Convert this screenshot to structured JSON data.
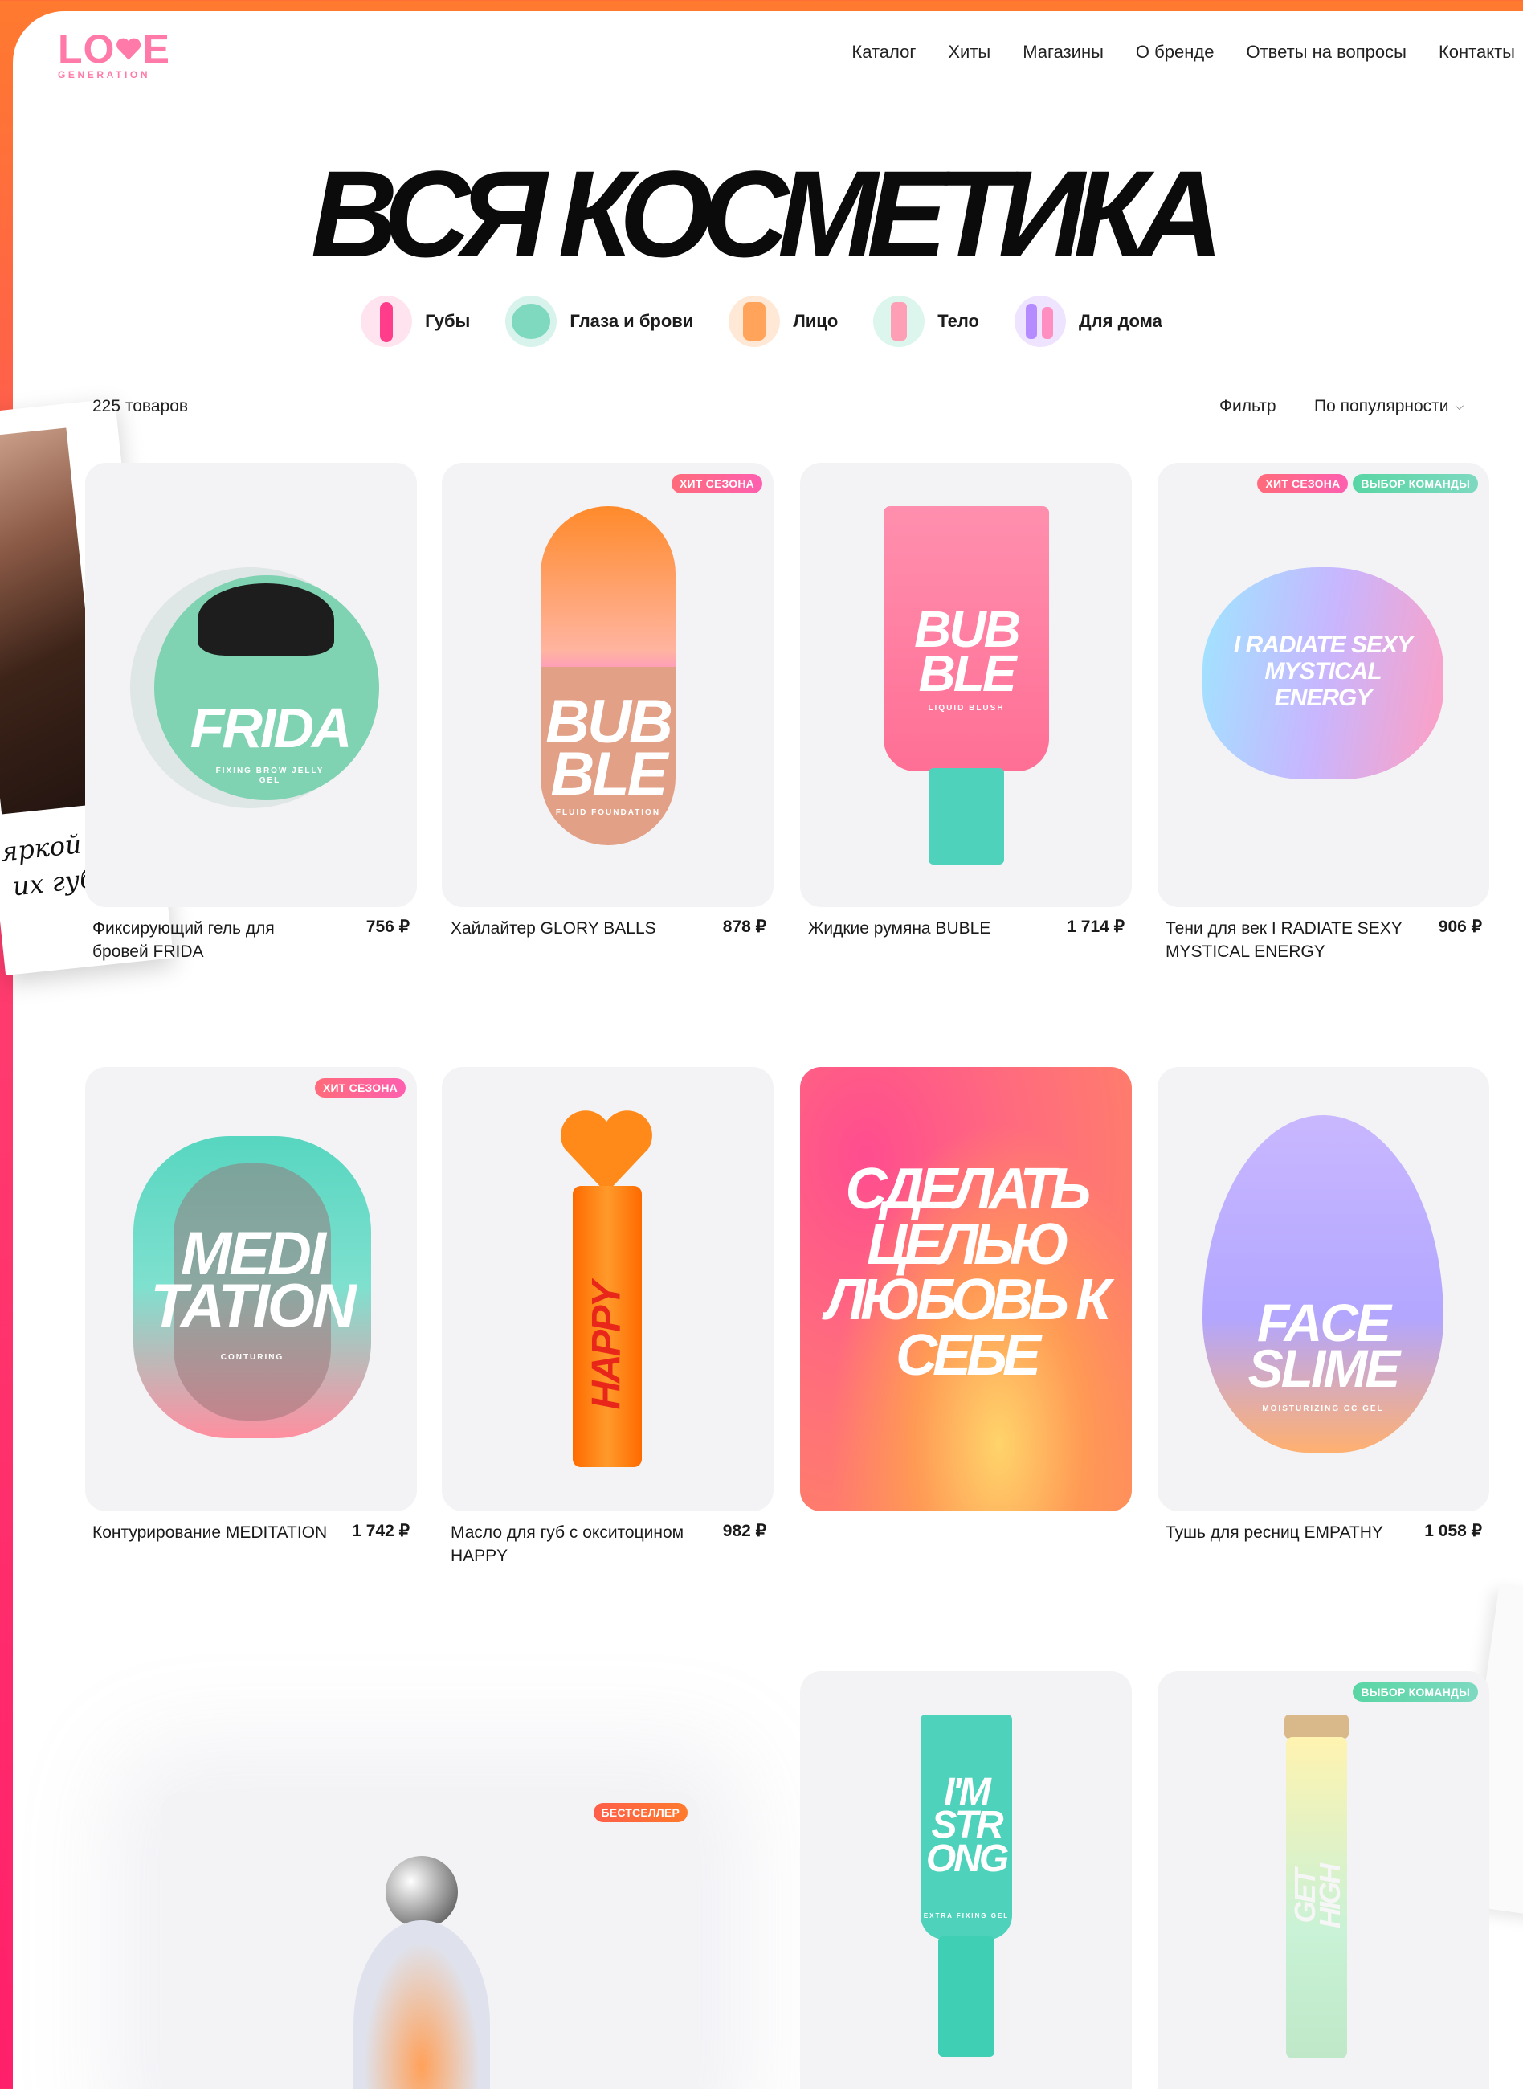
{
  "brand": {
    "logo_top": "L♥VE",
    "logo_sub": "GENERATION",
    "logo_color": "#ff7aa8"
  },
  "nav": [
    "Каталог",
    "Хиты",
    "Магазины",
    "О бренде",
    "Ответы на вопросы",
    "Контакты"
  ],
  "page_title": "ВСЯ КОСМЕТИКА",
  "categories": [
    "Губы",
    "Глаза и брови",
    "Лицо",
    "Тело",
    "Для дома"
  ],
  "toolbar": {
    "count": "225 товаров",
    "filter": "Фильтр",
    "sort": "По популярности"
  },
  "badges": {
    "hit": "ХИТ СЕЗОНА",
    "team": "ВЫБОР КОМАНДЫ",
    "best": "БЕСТСЕЛЛЕР"
  },
  "products": [
    {
      "name": "Фиксирующий гель для бровей FRIDA",
      "price": "756 ₽",
      "label": "FRIDA",
      "sub": "FIXING BROW JELLY GEL"
    },
    {
      "name": "Хайлайтер GLORY BALLS",
      "price": "878 ₽",
      "label": "BUB BLE",
      "sub": "FLUID FOUNDATION"
    },
    {
      "name": "Жидкие румяна BUBLE",
      "price": "1 714 ₽",
      "label": "BUB BLE",
      "sub": "LIQUID BLUSH"
    },
    {
      "name": "Тени для век I RADIATE SEXY MYSTICAL ENERGY",
      "price": "906 ₽",
      "label": "I RADIATE SEXY MYSTICAL ENERGY",
      "sub": ""
    },
    {
      "name": "Контурирование MEDITATION",
      "price": "1 742 ₽",
      "label": "MEDI TATION",
      "sub": "CONTURING"
    },
    {
      "name": "Масло для губ с окситоцином HAPPY",
      "price": "982 ₽",
      "label": "HAPPY",
      "sub": ""
    },
    {
      "name": "Тушь для ресниц EMPATHY",
      "price": "1 058 ₽",
      "label": "FACE SLIME",
      "sub": "MOISTURIZING CC GEL"
    },
    {
      "name": "",
      "price": "",
      "label": "I'M STR ONG",
      "sub": "EXTRA FIXING GEL"
    },
    {
      "name": "",
      "price": "",
      "label": "GET HIGH",
      "sub": ""
    }
  ],
  "promo": "СДЕЛАТЬ ЦЕЛЬЮ ЛЮБОВЬ К СЕБЕ",
  "polaroid_caption": "яркой\nих губах",
  "colors": {
    "accent_pink": "#ff4d8f",
    "accent_orange": "#ff7a2f",
    "mint": "#5fd6b8"
  }
}
